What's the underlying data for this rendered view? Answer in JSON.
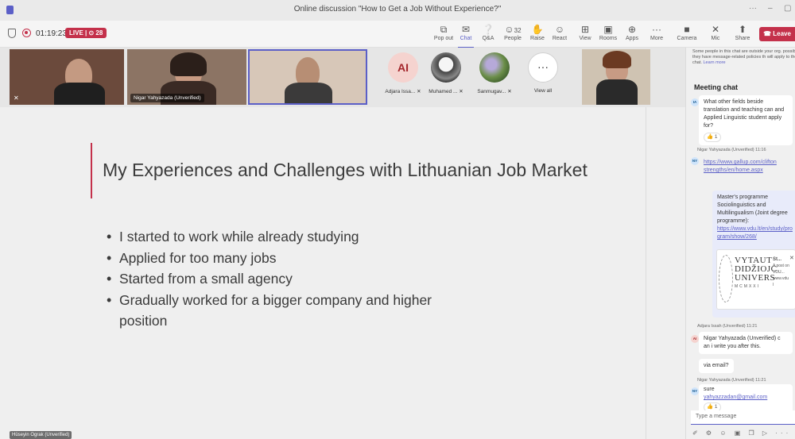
{
  "window": {
    "title": "Online discussion \"How to Get a Job Without Experience?\"",
    "controls": [
      "···",
      "–",
      "▢"
    ]
  },
  "toolbar": {
    "timer": "01:19:23",
    "live_badge": "LIVE | ⊙ 28",
    "buttons": [
      {
        "label": "Pop out",
        "icon": "⧉"
      },
      {
        "label": "Chat",
        "icon": "✉"
      },
      {
        "label": "Q&A",
        "icon": "❔"
      },
      {
        "label": "People",
        "icon": "☺",
        "count": "32"
      },
      {
        "label": "Raise",
        "icon": "✋"
      },
      {
        "label": "React",
        "icon": "☺"
      },
      {
        "label": "View",
        "icon": "⊞"
      },
      {
        "label": "Rooms",
        "icon": "▣"
      },
      {
        "label": "Apps",
        "icon": "⊕"
      },
      {
        "label": "More",
        "icon": "···"
      },
      {
        "label": "Camera",
        "icon": "■"
      },
      {
        "label": "Mic",
        "icon": "✕"
      },
      {
        "label": "Share",
        "icon": "⬆"
      }
    ],
    "leave_label": "Leave"
  },
  "participants": {
    "tile2_name": "Nigar Yahyazada (Unverified)",
    "avatars": [
      {
        "initials": "AI",
        "label": "Adjara Issa..."
      },
      {
        "label": "Muhamed ..."
      },
      {
        "label": "Sanmugav..."
      },
      {
        "label": "View all"
      }
    ],
    "presenter": "Hüseyin Ograk (Unverified)"
  },
  "slide": {
    "title": "My Experiences and Challenges with Lithuanian Job Market",
    "bullets": [
      "I started to work while already studying",
      "Applied for too many jobs",
      "Started from a small agency",
      "Gradually worked for a bigger company and higher position"
    ]
  },
  "chat": {
    "notice": "Some people in this chat are outside your org. possible they have message-related policies th will apply to the chat.",
    "notice_link": "Learn more",
    "heading": "Meeting chat",
    "msg1": {
      "avatar": "IA",
      "text": "What other fields beside translation and teaching can and Applied Linguistic student apply for?",
      "reaction": "👍 1"
    },
    "msg2": {
      "meta": "Nigar Yahyazada (Unverified)  11:16",
      "avatar": "NY",
      "link": "https://www.gallup.com/clifton strengths/en/home.aspx"
    },
    "msg3": {
      "text": "Master's programme Sociolinguistics and Multilingualism (Joint degree programme):",
      "link": "https://www.vdu.lt/en/study/program/show/268/",
      "card_lines": [
        "VYTAUT",
        "DIDŽIOJC",
        "UNIVERS",
        "MCMXXI"
      ],
      "card_side": [
        "St...",
        "A post on",
        "VDU...",
        "www.vdu",
        "I"
      ],
      "card_close": "✕"
    },
    "msg4": {
      "meta": "Adjara Issah (Unverified)  11:21",
      "avatar": "AI",
      "text": "Nigar Yahyazada (Unverified) c an i write you after this.",
      "followup": "via email?"
    },
    "msg5": {
      "meta": "Nigar Yahyazada (Unverified)  11:21",
      "avatar": "NY",
      "text": "sure",
      "email": "yahyazzadan@gmail.com",
      "reaction": "👍 1"
    },
    "input_placeholder": "Type a message",
    "compose_icons": "✐ ⚙ ☺ ▣ ❐ ▷ ···"
  }
}
